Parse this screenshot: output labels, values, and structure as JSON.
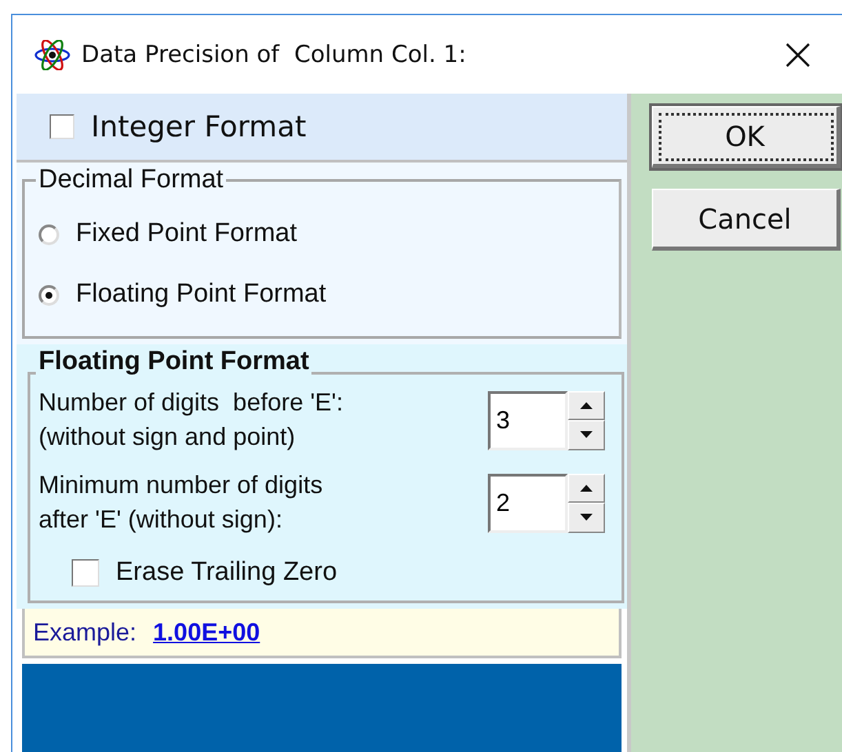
{
  "window": {
    "title": "Data Precision of  Column Col. 1:"
  },
  "integer_format": {
    "label": "Integer Format",
    "checked": false
  },
  "decimal_format": {
    "title": "Decimal Format",
    "options": [
      {
        "label": "Fixed Point Format",
        "selected": false
      },
      {
        "label": "Floating Point Format",
        "selected": true
      }
    ]
  },
  "floating_point_format": {
    "title": "Floating Point Format",
    "fields": [
      {
        "label": "Number of digits  before 'E':\n(without sign and point)",
        "value": "3"
      },
      {
        "label": "Minimum number of digits\nafter 'E' (without sign):",
        "value": "2"
      }
    ],
    "erase_trailing_zero": {
      "label": "Erase Trailing Zero",
      "checked": false
    }
  },
  "example": {
    "label": "Example:",
    "value": "1.00E+00"
  },
  "buttons": [
    {
      "label": "OK",
      "focused": true
    },
    {
      "label": "Cancel",
      "focused": false
    }
  ]
}
